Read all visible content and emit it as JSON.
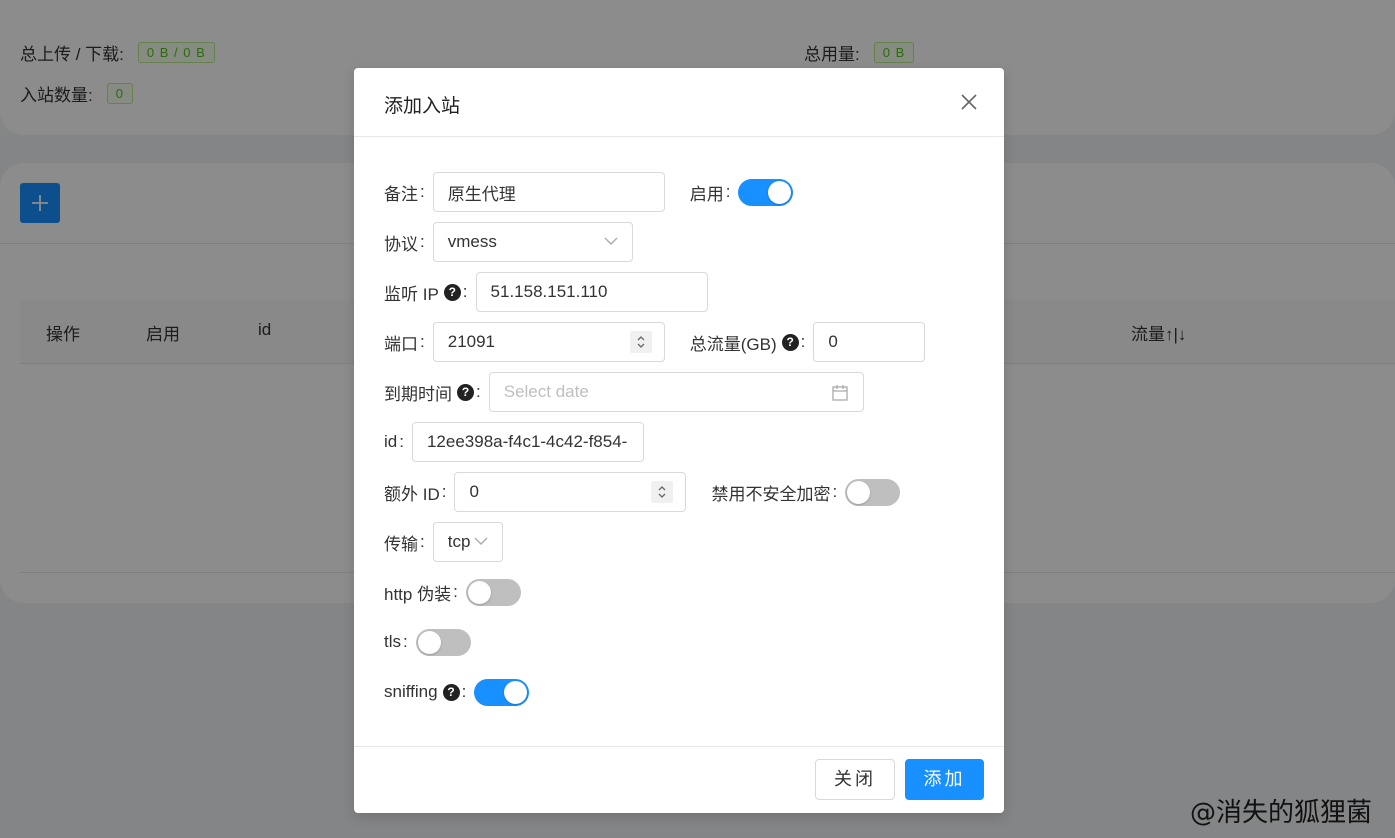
{
  "stats": {
    "upload_download_label": "总上传 / 下载:",
    "upload_download_value": "0 B / 0 B",
    "inbound_count_label": "入站数量:",
    "inbound_count_value": "0",
    "total_usage_label": "总用量:",
    "total_usage_value": "0 B"
  },
  "toolbar": {
    "add_icon": "plus-icon"
  },
  "table": {
    "columns": [
      "操作",
      "启用",
      "id",
      "流量↑|↓"
    ]
  },
  "modal": {
    "title": "添加入站",
    "fields": {
      "remark": {
        "label": "备注",
        "value": "原生代理"
      },
      "enable": {
        "label": "启用",
        "on": true
      },
      "protocol": {
        "label": "协议",
        "value": "vmess"
      },
      "listen_ip": {
        "label": "监听 IP",
        "value": "51.158.151.110"
      },
      "port": {
        "label": "端口",
        "value": "21091"
      },
      "total_traffic": {
        "label": "总流量(GB)",
        "value": "0"
      },
      "expire": {
        "label": "到期时间",
        "placeholder": "Select date"
      },
      "id": {
        "label": "id",
        "value": "12ee398a-f4c1-4c42-f854-"
      },
      "alter_id": {
        "label": "额外 ID",
        "value": "0"
      },
      "disable_insecure": {
        "label": "禁用不安全加密",
        "on": false
      },
      "transport": {
        "label": "传输",
        "value": "tcp"
      },
      "http_camouflage": {
        "label": "http 伪装",
        "on": false
      },
      "tls": {
        "label": "tls",
        "on": false
      },
      "sniffing": {
        "label": "sniffing",
        "on": true
      }
    },
    "help_glyph": "?",
    "colon": ":",
    "buttons": {
      "close": "关闭",
      "add": "添加"
    }
  },
  "watermark": "@消失的狐狸菌",
  "colors": {
    "primary": "#1890ff",
    "tag_green": "#52c41a"
  }
}
